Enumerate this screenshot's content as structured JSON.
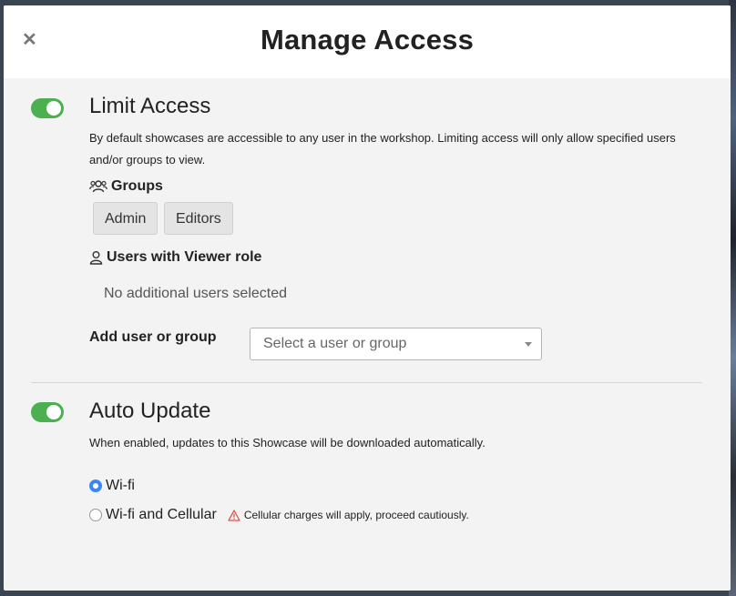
{
  "modal": {
    "title": "Manage Access",
    "close_icon": "close-icon"
  },
  "limit_access": {
    "title": "Limit Access",
    "enabled": true,
    "description": "By default showcases are accessible to any user in the workshop. Limiting access will only allow specified users and/or groups to view.",
    "groups_heading": "Groups",
    "groups_icon": "groups-icon",
    "groups": [
      "Admin",
      "Editors"
    ],
    "users_heading": "Users with Viewer role",
    "users_icon": "user-icon",
    "users_empty": "No additional users selected",
    "add_label": "Add user or group",
    "select_placeholder": "Select a user or group"
  },
  "auto_update": {
    "title": "Auto Update",
    "enabled": true,
    "description": "When enabled, updates to this Showcase will be downloaded automatically.",
    "options": [
      {
        "label": "Wi-fi",
        "selected": true
      },
      {
        "label": "Wi-fi and Cellular",
        "selected": false
      }
    ],
    "warning_icon": "warning-icon",
    "warning": "Cellular charges will apply, proceed cautiously."
  },
  "colors": {
    "toggle_on": "#4caf50",
    "radio_selected": "#3d86f6",
    "warning": "#d9534f"
  }
}
